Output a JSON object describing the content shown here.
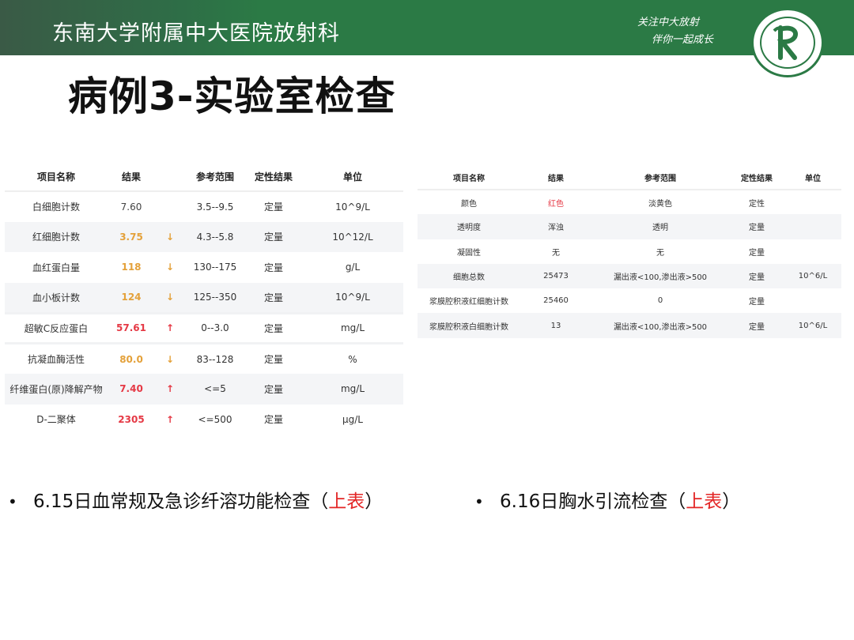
{
  "header": {
    "hospital": "东南大学附属中大医院放射科",
    "slogan_line1": "关注中大放射",
    "slogan_line2": "伴你一起成长",
    "logo_icon": "hospital-logo-icon",
    "brand_color": "#2b7a45"
  },
  "title": "病例3-实验室检查",
  "table1": {
    "headers": [
      "项目名称",
      "结果",
      "参考范围",
      "定性结果",
      "单位"
    ],
    "rows": [
      {
        "name": "白细胞计数",
        "result": "7.60",
        "flag": "",
        "range": "3.5--9.5",
        "qual": "定量",
        "unit": "10^9/L"
      },
      {
        "name": "红细胞计数",
        "result": "3.75",
        "flag": "↓",
        "range": "4.3--5.8",
        "qual": "定量",
        "unit": "10^12/L"
      },
      {
        "name": "血红蛋白量",
        "result": "118",
        "flag": "↓",
        "range": "130--175",
        "qual": "定量",
        "unit": "g/L"
      },
      {
        "name": "血小板计数",
        "result": "124",
        "flag": "↓",
        "range": "125--350",
        "qual": "定量",
        "unit": "10^9/L"
      },
      {
        "name": "超敏C反应蛋白",
        "result": "57.61",
        "flag": "↑",
        "range": "0--3.0",
        "qual": "定量",
        "unit": "mg/L"
      },
      {
        "name": "抗凝血酶活性",
        "result": "80.0",
        "flag": "↓",
        "range": "83--128",
        "qual": "定量",
        "unit": "%"
      },
      {
        "name": "纤维蛋白(原)降解产物",
        "result": "7.40",
        "flag": "↑",
        "range": "<=5",
        "qual": "定量",
        "unit": "mg/L"
      },
      {
        "name": "D-二聚体",
        "result": "2305",
        "flag": "↑",
        "range": "<=500",
        "qual": "定量",
        "unit": "μg/L"
      }
    ]
  },
  "table2": {
    "headers": [
      "项目名称",
      "结果",
      "参考范围",
      "定性结果",
      "单位"
    ],
    "rows": [
      {
        "name": "颜色",
        "result": "红色",
        "range": "淡黄色",
        "qual": "定性",
        "unit": ""
      },
      {
        "name": "透明度",
        "result": "浑浊",
        "range": "透明",
        "qual": "定量",
        "unit": ""
      },
      {
        "name": "凝固性",
        "result": "无",
        "range": "无",
        "qual": "定量",
        "unit": ""
      },
      {
        "name": "细胞总数",
        "result": "25473",
        "range": "漏出液<100,渗出液>500",
        "qual": "定量",
        "unit": "10^6/L"
      },
      {
        "name": "浆膜腔积液红细胞计数",
        "result": "25460",
        "range": "0",
        "qual": "定量",
        "unit": ""
      },
      {
        "name": "浆膜腔积液白细胞计数",
        "result": "13",
        "range": "漏出液<100,渗出液>500",
        "qual": "定量",
        "unit": "10^6/L"
      }
    ]
  },
  "bullets": [
    {
      "text": "6.15日血常规及急诊纤溶功能检查（",
      "highlight": "上表",
      "end": "）"
    },
    {
      "text": "6.16日胸水引流检查（",
      "highlight": "上表",
      "end": "）"
    }
  ],
  "colors": {
    "high": "#e53945",
    "low": "#e4a13a",
    "highlight": "#e32626"
  }
}
